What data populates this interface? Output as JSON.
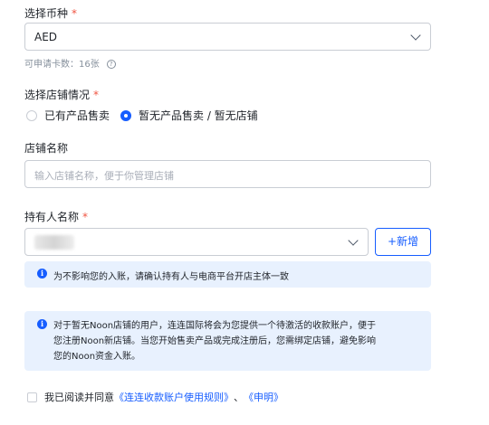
{
  "currency": {
    "label": "选择币种",
    "required_mark": "*",
    "selected": "AED",
    "hint": "可申请卡数：16张",
    "hint_icon": "?"
  },
  "store_status": {
    "label": "选择店铺情况",
    "required_mark": "*",
    "options": [
      {
        "label": "已有产品售卖",
        "selected": false
      },
      {
        "label": "暂无产品售卖 / 暂无店铺",
        "selected": true
      }
    ]
  },
  "store_name": {
    "label": "店铺名称",
    "placeholder": "输入店铺名称，便于你管理店铺"
  },
  "holder": {
    "label": "持有人名称",
    "required_mark": "*",
    "add_label": "+新增",
    "info_icon": "i",
    "notice": "为不影响您的入账，请确认持有人与电商平台开店主体一致"
  },
  "info_box": {
    "icon": "i",
    "line1": "对于暂无Noon店铺的用户，连连国际将会为您提供一个待激活的收款账户，便于",
    "line2": "您注册Noon新店铺。当您开始售卖产品或完成注册后，您需绑定店铺，避免影响",
    "line3": "您的Noon资金入账。"
  },
  "agreement": {
    "prefix": "我已阅读并同意",
    "link1": "《连连收款账户使用规则》",
    "separator": "、",
    "link2": "《申明》"
  },
  "colors": {
    "accent": "#165dff",
    "required": "#f05442",
    "notice_bg": "#e8f1fe"
  }
}
